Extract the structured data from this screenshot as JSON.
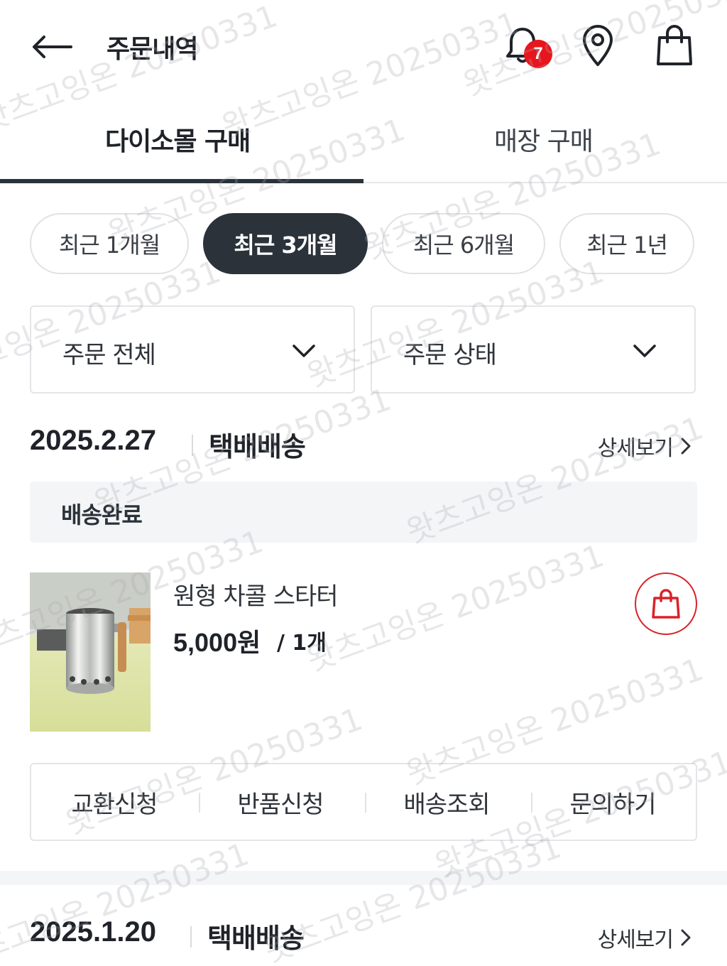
{
  "header": {
    "title": "주문내역",
    "back_icon": "arrow-left-icon",
    "notification_count": "7",
    "icons": [
      "bell-icon",
      "location-pin-icon",
      "shopping-bag-icon"
    ]
  },
  "tabs": [
    {
      "label": "다이소몰 구매",
      "active": true
    },
    {
      "label": "매장 구매",
      "active": false
    }
  ],
  "period_filters": [
    {
      "label": "최근 1개월",
      "active": false
    },
    {
      "label": "최근 3개월",
      "active": true
    },
    {
      "label": "최근 6개월",
      "active": false
    },
    {
      "label": "최근 1년",
      "active": false
    }
  ],
  "filters": {
    "order_type": "주문 전체",
    "order_status": "주문 상태"
  },
  "orders": [
    {
      "date": "2025.2.27",
      "delivery_type": "택배배송",
      "detail_label": "상세보기",
      "status": "배송완료",
      "product": {
        "name": "원형 차콜 스타터",
        "price": "5,000원",
        "quantity": "/ 1개"
      },
      "actions": [
        "교환신청",
        "반품신청",
        "배송조회",
        "문의하기"
      ]
    },
    {
      "date": "2025.1.20",
      "delivery_type": "택배배송",
      "detail_label": "상세보기"
    }
  ],
  "watermark": "왓츠고잉온 20250331",
  "colors": {
    "accent_dark": "#2b323a",
    "badge_red": "#e8151d",
    "cart_red": "#d9232a",
    "status_bg": "#f4f5f7"
  }
}
